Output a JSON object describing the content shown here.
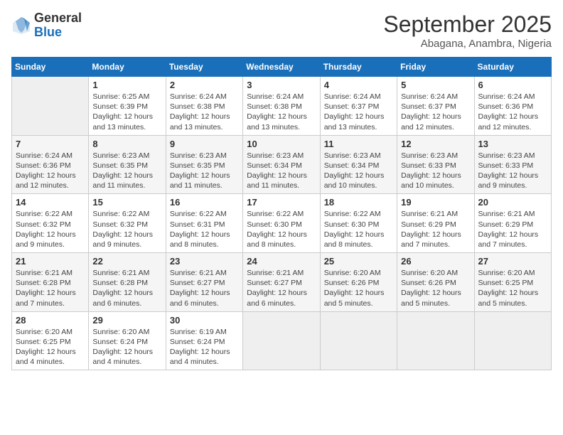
{
  "header": {
    "logo_general": "General",
    "logo_blue": "Blue",
    "month_title": "September 2025",
    "location": "Abagana, Anambra, Nigeria"
  },
  "days_of_week": [
    "Sunday",
    "Monday",
    "Tuesday",
    "Wednesday",
    "Thursday",
    "Friday",
    "Saturday"
  ],
  "weeks": [
    [
      {
        "day": "",
        "info": ""
      },
      {
        "day": "1",
        "info": "Sunrise: 6:25 AM\nSunset: 6:39 PM\nDaylight: 12 hours\nand 13 minutes."
      },
      {
        "day": "2",
        "info": "Sunrise: 6:24 AM\nSunset: 6:38 PM\nDaylight: 12 hours\nand 13 minutes."
      },
      {
        "day": "3",
        "info": "Sunrise: 6:24 AM\nSunset: 6:38 PM\nDaylight: 12 hours\nand 13 minutes."
      },
      {
        "day": "4",
        "info": "Sunrise: 6:24 AM\nSunset: 6:37 PM\nDaylight: 12 hours\nand 13 minutes."
      },
      {
        "day": "5",
        "info": "Sunrise: 6:24 AM\nSunset: 6:37 PM\nDaylight: 12 hours\nand 12 minutes."
      },
      {
        "day": "6",
        "info": "Sunrise: 6:24 AM\nSunset: 6:36 PM\nDaylight: 12 hours\nand 12 minutes."
      }
    ],
    [
      {
        "day": "7",
        "info": "Sunrise: 6:24 AM\nSunset: 6:36 PM\nDaylight: 12 hours\nand 12 minutes."
      },
      {
        "day": "8",
        "info": "Sunrise: 6:23 AM\nSunset: 6:35 PM\nDaylight: 12 hours\nand 11 minutes."
      },
      {
        "day": "9",
        "info": "Sunrise: 6:23 AM\nSunset: 6:35 PM\nDaylight: 12 hours\nand 11 minutes."
      },
      {
        "day": "10",
        "info": "Sunrise: 6:23 AM\nSunset: 6:34 PM\nDaylight: 12 hours\nand 11 minutes."
      },
      {
        "day": "11",
        "info": "Sunrise: 6:23 AM\nSunset: 6:34 PM\nDaylight: 12 hours\nand 10 minutes."
      },
      {
        "day": "12",
        "info": "Sunrise: 6:23 AM\nSunset: 6:33 PM\nDaylight: 12 hours\nand 10 minutes."
      },
      {
        "day": "13",
        "info": "Sunrise: 6:23 AM\nSunset: 6:33 PM\nDaylight: 12 hours\nand 9 minutes."
      }
    ],
    [
      {
        "day": "14",
        "info": "Sunrise: 6:22 AM\nSunset: 6:32 PM\nDaylight: 12 hours\nand 9 minutes."
      },
      {
        "day": "15",
        "info": "Sunrise: 6:22 AM\nSunset: 6:32 PM\nDaylight: 12 hours\nand 9 minutes."
      },
      {
        "day": "16",
        "info": "Sunrise: 6:22 AM\nSunset: 6:31 PM\nDaylight: 12 hours\nand 8 minutes."
      },
      {
        "day": "17",
        "info": "Sunrise: 6:22 AM\nSunset: 6:30 PM\nDaylight: 12 hours\nand 8 minutes."
      },
      {
        "day": "18",
        "info": "Sunrise: 6:22 AM\nSunset: 6:30 PM\nDaylight: 12 hours\nand 8 minutes."
      },
      {
        "day": "19",
        "info": "Sunrise: 6:21 AM\nSunset: 6:29 PM\nDaylight: 12 hours\nand 7 minutes."
      },
      {
        "day": "20",
        "info": "Sunrise: 6:21 AM\nSunset: 6:29 PM\nDaylight: 12 hours\nand 7 minutes."
      }
    ],
    [
      {
        "day": "21",
        "info": "Sunrise: 6:21 AM\nSunset: 6:28 PM\nDaylight: 12 hours\nand 7 minutes."
      },
      {
        "day": "22",
        "info": "Sunrise: 6:21 AM\nSunset: 6:28 PM\nDaylight: 12 hours\nand 6 minutes."
      },
      {
        "day": "23",
        "info": "Sunrise: 6:21 AM\nSunset: 6:27 PM\nDaylight: 12 hours\nand 6 minutes."
      },
      {
        "day": "24",
        "info": "Sunrise: 6:21 AM\nSunset: 6:27 PM\nDaylight: 12 hours\nand 6 minutes."
      },
      {
        "day": "25",
        "info": "Sunrise: 6:20 AM\nSunset: 6:26 PM\nDaylight: 12 hours\nand 5 minutes."
      },
      {
        "day": "26",
        "info": "Sunrise: 6:20 AM\nSunset: 6:26 PM\nDaylight: 12 hours\nand 5 minutes."
      },
      {
        "day": "27",
        "info": "Sunrise: 6:20 AM\nSunset: 6:25 PM\nDaylight: 12 hours\nand 5 minutes."
      }
    ],
    [
      {
        "day": "28",
        "info": "Sunrise: 6:20 AM\nSunset: 6:25 PM\nDaylight: 12 hours\nand 4 minutes."
      },
      {
        "day": "29",
        "info": "Sunrise: 6:20 AM\nSunset: 6:24 PM\nDaylight: 12 hours\nand 4 minutes."
      },
      {
        "day": "30",
        "info": "Sunrise: 6:19 AM\nSunset: 6:24 PM\nDaylight: 12 hours\nand 4 minutes."
      },
      {
        "day": "",
        "info": ""
      },
      {
        "day": "",
        "info": ""
      },
      {
        "day": "",
        "info": ""
      },
      {
        "day": "",
        "info": ""
      }
    ]
  ]
}
